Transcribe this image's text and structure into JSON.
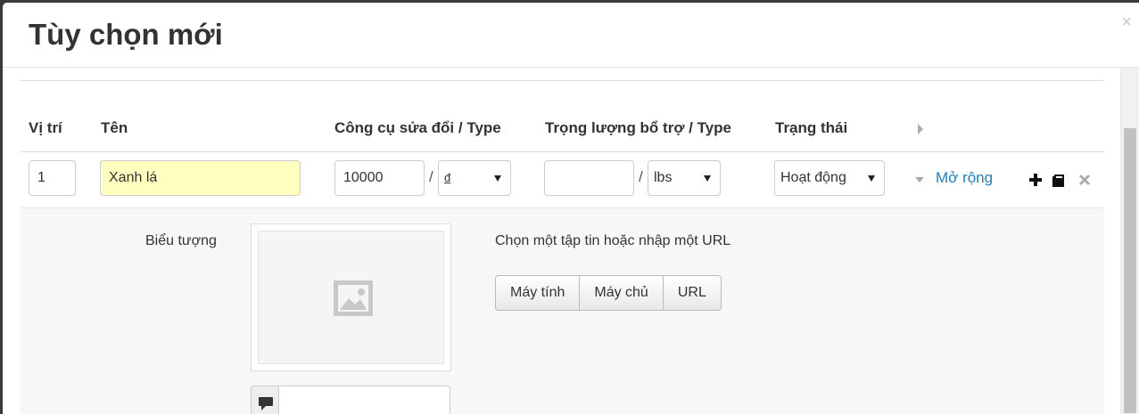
{
  "modal": {
    "title": "Tùy chọn mới",
    "close_glyph": "×"
  },
  "table": {
    "headers": {
      "position": "Vị trí",
      "name": "Tên",
      "modifier": "Công cụ sửa đổi / Type",
      "weight": "Trọng lượng bổ trợ / Type",
      "status": "Trạng thái"
    },
    "row": {
      "position": "1",
      "name": "Xanh lá",
      "price": "10000",
      "price_type": "đ",
      "weight": "",
      "weight_type": "lbs",
      "status": "Hoạt động",
      "expand_label": "Mở rộng",
      "slash": "/"
    },
    "row_actions": [
      "plus-icon",
      "clone-icon",
      "delete-icon"
    ]
  },
  "detail": {
    "icon_label": "Biểu tượng",
    "choose_text": "Chọn một tập tin hoặc nhập một URL",
    "source_buttons": [
      "Máy tính",
      "Máy chủ",
      "URL"
    ],
    "image_placeholder_icon": "image-icon",
    "comment_icon": "comment-icon"
  },
  "colors": {
    "link": "#1a80c8",
    "highlight_input": "#ffffc0"
  }
}
